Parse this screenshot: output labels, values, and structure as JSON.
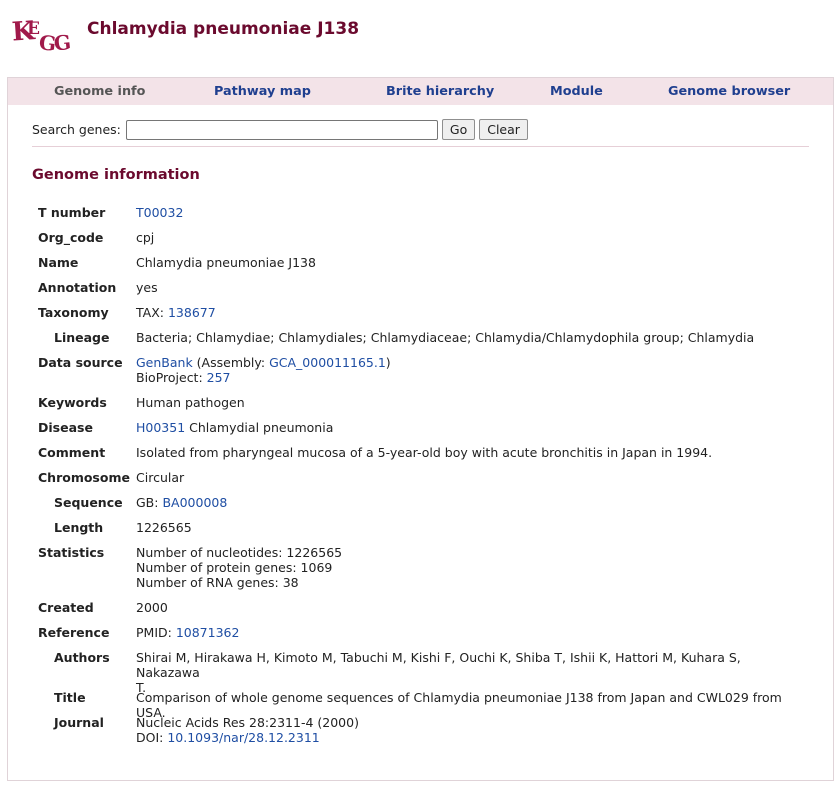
{
  "header": {
    "logo_text": "KEGG",
    "title": "Chlamydia pneumoniae J138"
  },
  "nav": {
    "tabs": [
      "Genome info",
      "Pathway map",
      "Brite hierarchy",
      "Module",
      "Genome browser"
    ],
    "active_index": 0
  },
  "search": {
    "label": "Search genes:",
    "value": "",
    "go_label": "Go",
    "clear_label": "Clear"
  },
  "section_title": "Genome information",
  "rows": [
    {
      "key": "t_number",
      "label": "T number",
      "sub": false,
      "lines": [
        [
          {
            "t": "T00032",
            "link": true
          }
        ]
      ]
    },
    {
      "key": "org_code",
      "label": "Org_code",
      "sub": false,
      "lines": [
        [
          {
            "t": "cpj"
          }
        ]
      ]
    },
    {
      "key": "name",
      "label": "Name",
      "sub": false,
      "lines": [
        [
          {
            "t": "Chlamydia pneumoniae J138"
          }
        ]
      ]
    },
    {
      "key": "annotation",
      "label": "Annotation",
      "sub": false,
      "lines": [
        [
          {
            "t": "yes"
          }
        ]
      ]
    },
    {
      "key": "taxonomy",
      "label": "Taxonomy",
      "sub": false,
      "lines": [
        [
          {
            "t": "TAX: "
          },
          {
            "t": "138677",
            "link": true
          }
        ]
      ]
    },
    {
      "key": "lineage",
      "label": "Lineage",
      "sub": true,
      "lines": [
        [
          {
            "t": "Bacteria; Chlamydiae; Chlamydiales; Chlamydiaceae; Chlamydia/Chlamydophila group; Chlamydia"
          }
        ]
      ]
    },
    {
      "key": "data_source",
      "label": "Data source",
      "sub": false,
      "lines": [
        [
          {
            "t": "GenBank",
            "link": true
          },
          {
            "t": " (Assembly: "
          },
          {
            "t": "GCA_000011165.1",
            "link": true
          },
          {
            "t": ")"
          }
        ],
        [
          {
            "t": "BioProject: "
          },
          {
            "t": "257",
            "link": true
          }
        ]
      ]
    },
    {
      "key": "keywords",
      "label": "Keywords",
      "sub": false,
      "lines": [
        [
          {
            "t": "Human pathogen"
          }
        ]
      ]
    },
    {
      "key": "disease",
      "label": "Disease",
      "sub": false,
      "lines": [
        [
          {
            "t": "H00351",
            "link": true
          },
          {
            "t": " Chlamydial pneumonia"
          }
        ]
      ]
    },
    {
      "key": "comment",
      "label": "Comment",
      "sub": false,
      "lines": [
        [
          {
            "t": "Isolated from pharyngeal mucosa of a 5-year-old boy with acute bronchitis in Japan in 1994."
          }
        ]
      ]
    },
    {
      "key": "chromosome",
      "label": "Chromosome",
      "sub": false,
      "lines": [
        [
          {
            "t": "Circular"
          }
        ]
      ]
    },
    {
      "key": "sequence",
      "label": "Sequence",
      "sub": true,
      "lines": [
        [
          {
            "t": "GB: "
          },
          {
            "t": "BA000008",
            "link": true
          }
        ]
      ]
    },
    {
      "key": "length",
      "label": "Length",
      "sub": true,
      "lines": [
        [
          {
            "t": "1226565"
          }
        ]
      ]
    },
    {
      "key": "statistics",
      "label": "Statistics",
      "sub": false,
      "lines": [
        [
          {
            "t": "Number of nucleotides: 1226565"
          }
        ],
        [
          {
            "t": "Number of protein genes: 1069"
          }
        ],
        [
          {
            "t": "Number of RNA genes: 38"
          }
        ]
      ]
    },
    {
      "key": "created",
      "label": "Created",
      "sub": false,
      "lines": [
        [
          {
            "t": "2000"
          }
        ]
      ]
    },
    {
      "key": "reference",
      "label": "Reference",
      "sub": false,
      "lines": [
        [
          {
            "t": "PMID: "
          },
          {
            "t": "10871362",
            "link": true
          }
        ]
      ]
    },
    {
      "key": "authors",
      "label": "Authors",
      "sub": true,
      "lines": [
        [
          {
            "t": "Shirai M, Hirakawa H, Kimoto M, Tabuchi M, Kishi F, Ouchi K, Shiba T, Ishii K, Hattori M, Kuhara S, Nakazawa"
          }
        ],
        [
          {
            "t": "T."
          }
        ]
      ]
    },
    {
      "key": "title",
      "label": "Title",
      "sub": true,
      "lines": [
        [
          {
            "t": "Comparison of whole genome sequences of Chlamydia pneumoniae J138 from Japan and CWL029 from USA."
          }
        ]
      ]
    },
    {
      "key": "journal",
      "label": "Journal",
      "sub": true,
      "lines": [
        [
          {
            "t": "Nucleic Acids Res 28:2311-4 (2000)"
          }
        ],
        [
          {
            "t": "DOI: "
          },
          {
            "t": "10.1093/nar/28.12.2311",
            "link": true
          }
        ]
      ]
    }
  ],
  "colors": {
    "title": "#6b0a2e",
    "link": "#1f4ea3",
    "nav_bg": "#f3e3e8",
    "logo": "#a0194a"
  }
}
